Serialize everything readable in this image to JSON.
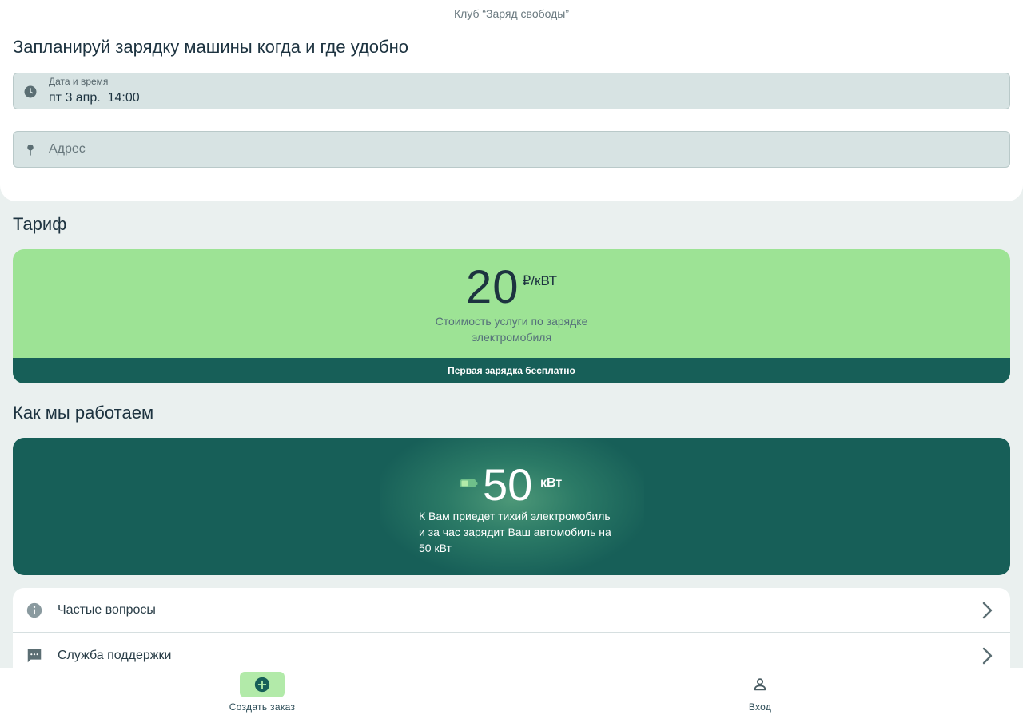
{
  "header": {
    "club_name": "Клуб “Заряд свободы”",
    "title": "Запланируй зарядку машины когда и где удобно"
  },
  "datetime_field": {
    "label": "Дата и время",
    "value": "пт 3 апр.  14:00",
    "icon": "clock-icon"
  },
  "address_field": {
    "placeholder": "Адрес",
    "value": "",
    "icon": "pin-icon"
  },
  "tariff": {
    "section_title": "Тариф",
    "price": "20",
    "unit": "₽/кВТ",
    "description": "Стоимость услуги по зарядке электромобиля",
    "promo": "Первая зарядка бесплатно"
  },
  "how_we_work": {
    "section_title": "Как мы работаем",
    "value": "50",
    "unit": "кВт",
    "description": "К Вам приедет тихий электромобиль и за час зарядит Ваш автомобиль на 50 кВт",
    "icon": "battery-icon"
  },
  "menu": {
    "items": [
      {
        "label": "Частые вопросы",
        "icon": "info-icon"
      },
      {
        "label": "Служба поддержки",
        "icon": "chat-icon"
      }
    ]
  },
  "bottom_nav": {
    "items": [
      {
        "label": "Создать заказ",
        "icon": "add-circle-icon",
        "active": true
      },
      {
        "label": "Вход",
        "icon": "person-icon",
        "active": false
      }
    ]
  },
  "colors": {
    "accent_dark": "#175f58",
    "accent_light": "#9de395",
    "background": "#eaf0ef",
    "field_bg": "#d7e3e3"
  }
}
